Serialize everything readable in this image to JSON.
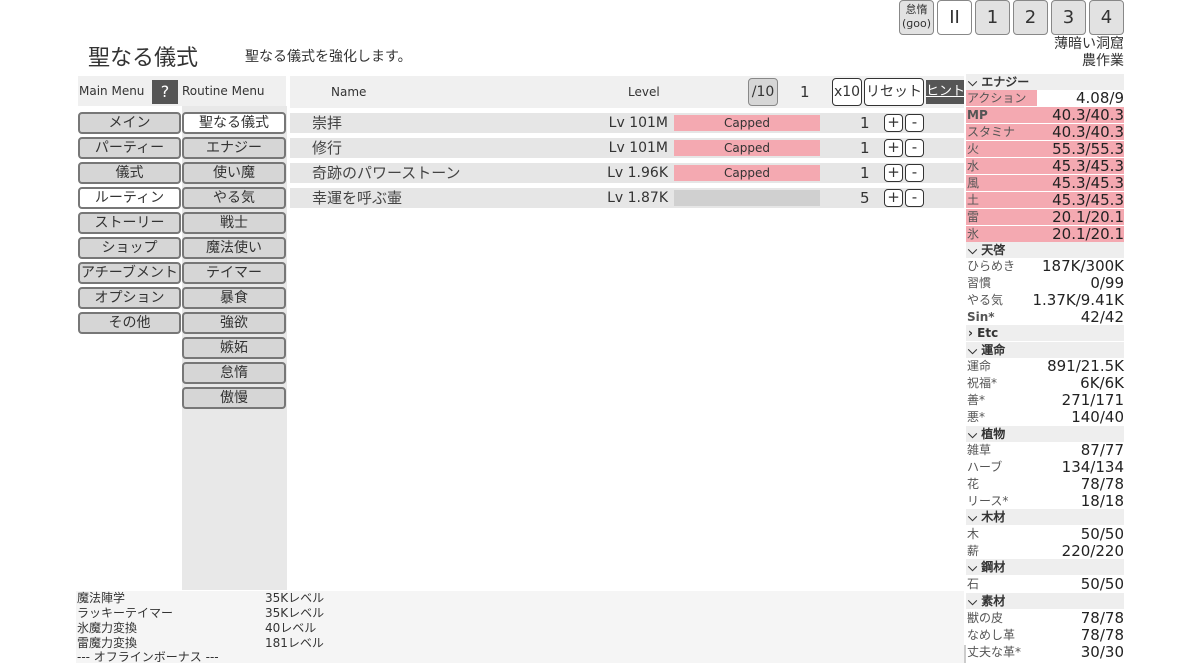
{
  "top_buttons": {
    "sloth_label": "怠惰",
    "sloth_face": "(ɡoo)",
    "pause": "II",
    "b1": "1",
    "b2": "2",
    "b3": "3",
    "b4": "4"
  },
  "location": {
    "line1": "薄暗い洞窟",
    "line2": "農作業"
  },
  "page": {
    "title": "聖なる儀式",
    "subtitle": "聖なる儀式を強化します。"
  },
  "menus": {
    "main_label": "Main Menu",
    "help": "?",
    "routine_label": "Routine Menu"
  },
  "main_menu": [
    "メイン",
    "パーティー",
    "儀式",
    "ルーティン",
    "ストーリー",
    "ショップ",
    "アチーブメント",
    "オプション",
    "その他"
  ],
  "routine_menu": [
    "聖なる儀式",
    "エナジー",
    "使い魔",
    "やる気",
    "戦士",
    "魔法使い",
    "テイマー",
    "暴食",
    "強欲",
    "嫉妬",
    "怠惰",
    "傲慢"
  ],
  "table": {
    "col_name": "Name",
    "col_level": "Level",
    "div10": "/10",
    "count": "1",
    "x10": "x10",
    "reset": "リセット",
    "hint": "ヒント",
    "rows": [
      {
        "name": "崇拝",
        "level": "Lv 101M",
        "status": "Capped",
        "count": "1",
        "fill": 1.0
      },
      {
        "name": "修行",
        "level": "Lv 101M",
        "status": "Capped",
        "count": "1",
        "fill": 1.0
      },
      {
        "name": "奇跡のパワーストーン",
        "level": "Lv 1.96K",
        "status": "Capped",
        "count": "1",
        "fill": 1.0
      },
      {
        "name": "幸運を呼ぶ壷",
        "level": "Lv 1.87K",
        "status": "",
        "count": "5",
        "fill": 0.0
      }
    ],
    "plus": "+",
    "minus": "-"
  },
  "sidebar": {
    "energy_head": "エナジー",
    "energy": [
      {
        "label": "アクション",
        "value": "4.08/9",
        "pink": true
      },
      {
        "label": "MP",
        "value": "40.3/40.3",
        "pink": true
      },
      {
        "label": "スタミナ",
        "value": "40.3/40.3",
        "pink": true
      },
      {
        "label": "火",
        "value": "55.3/55.3",
        "pink": true
      },
      {
        "label": "水",
        "value": "45.3/45.3",
        "pink": true
      },
      {
        "label": "風",
        "value": "45.3/45.3",
        "pink": true
      },
      {
        "label": "土",
        "value": "45.3/45.3",
        "pink": true
      },
      {
        "label": "雷",
        "value": "20.1/20.1",
        "pink": true
      },
      {
        "label": "氷",
        "value": "20.1/20.1",
        "pink": true
      }
    ],
    "tenkei_head": "天啓",
    "tenkei": [
      {
        "label": "ひらめき",
        "value": "187K/300K"
      },
      {
        "label": "習慣",
        "value": "0/99"
      },
      {
        "label": "やる気",
        "value": "1.37K/9.41K"
      },
      {
        "label": "Sin*",
        "value": "42/42"
      }
    ],
    "etc_head": "Etc",
    "fate_head": "運命",
    "fate": [
      {
        "label": "運命",
        "value": "891/21.5K"
      },
      {
        "label": "祝福*",
        "value": "6K/6K"
      },
      {
        "label": "善*",
        "value": "271/171"
      },
      {
        "label": "悪*",
        "value": "140/40"
      }
    ],
    "plant_head": "植物",
    "plants": [
      {
        "label": "雑草",
        "value": "87/77"
      },
      {
        "label": "ハーブ",
        "value": "134/134"
      },
      {
        "label": "花",
        "value": "78/78"
      },
      {
        "label": "リース*",
        "value": "18/18"
      }
    ],
    "wood_head": "木材",
    "wood": [
      {
        "label": "木",
        "value": "50/50"
      },
      {
        "label": "薪",
        "value": "220/220"
      }
    ],
    "ore_head": "鋼材",
    "ore": [
      {
        "label": "石",
        "value": "50/50"
      }
    ],
    "mat_head": "素材",
    "mats": [
      {
        "label": "獣の皮",
        "value": "78/78"
      },
      {
        "label": "なめし革",
        "value": "78/78"
      },
      {
        "label": "丈夫な革*",
        "value": "30/30"
      }
    ],
    "scroll_up": "▲"
  },
  "bottom": [
    {
      "label": "魔法陣学",
      "value": "35Kレベル"
    },
    {
      "label": "ラッキーテイマー",
      "value": "35Kレベル"
    },
    {
      "label": "氷魔力変換",
      "value": "40レベル"
    },
    {
      "label": "雷魔力変換",
      "value": "181レベル"
    }
  ],
  "offline": "--- オフラインボーナス ---"
}
